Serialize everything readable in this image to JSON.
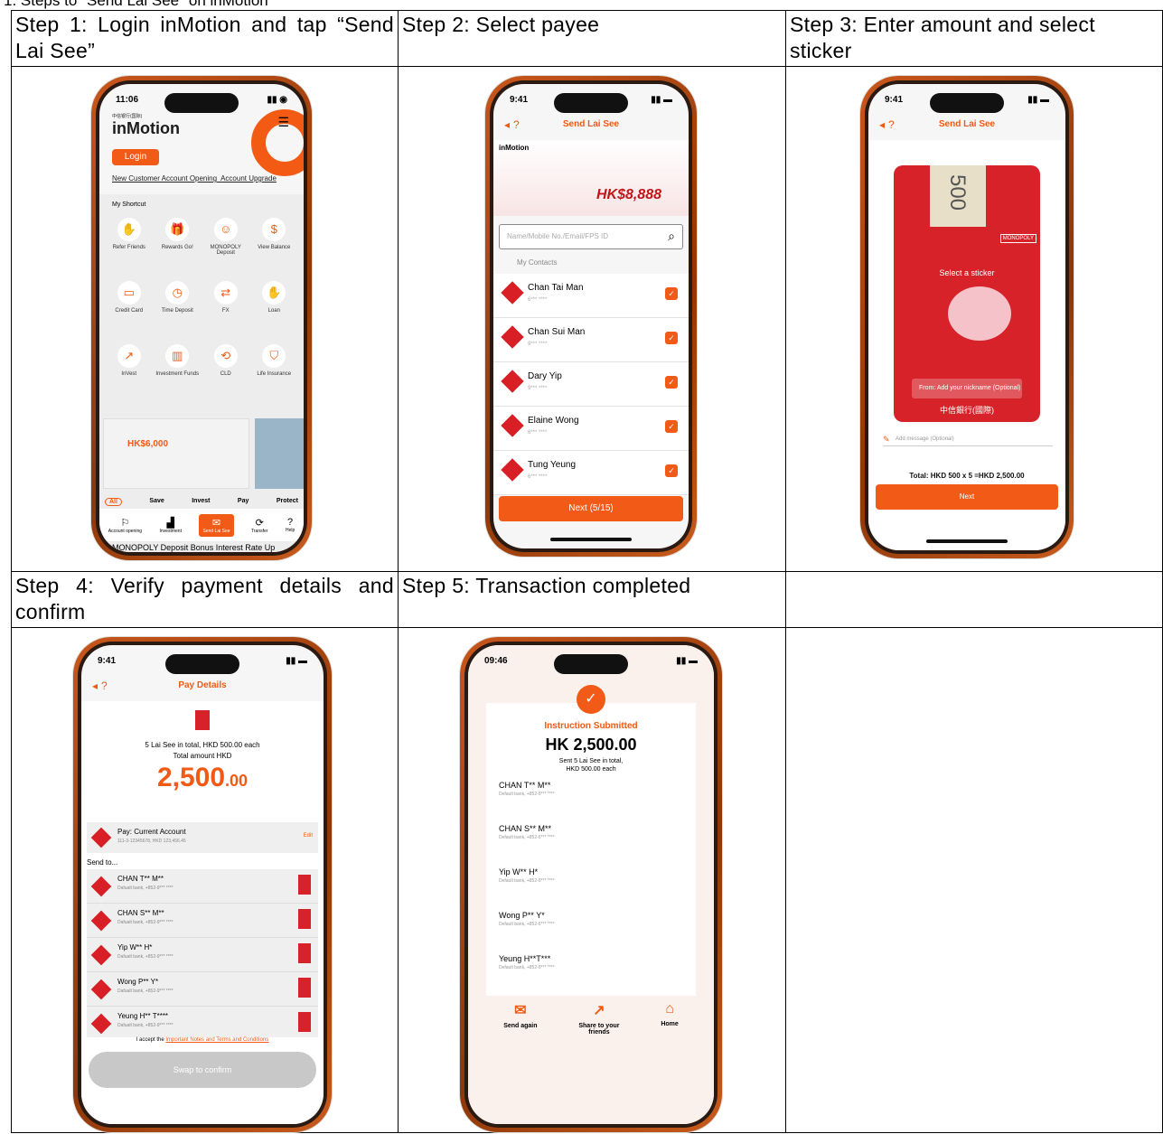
{
  "doc_title": "1.   Steps to \"Send Lai See\" on inMotion",
  "steps": [
    {
      "label": "Step 1: Login inMotion and tap “Send Lai See”"
    },
    {
      "label": "Step 2: Select payee"
    },
    {
      "label": "Step 3: Enter amount and select sticker"
    },
    {
      "label": "Step 4: Verify payment details and confirm"
    },
    {
      "label": "Step 5: Transaction completed"
    }
  ],
  "screen1": {
    "time": "11:06",
    "bank_name": "中信银行(国际)",
    "logo_text": "inMotion",
    "login_label": "Login",
    "link1": "New Customer Account Opening",
    "link2": "Account Upgrade",
    "shortcut_title": "My Shortcut",
    "shortcuts": [
      "Refer Friends",
      "Rewards Go!",
      "MONOPOLY Deposit",
      "View Balance",
      "Credit Card",
      "Time Deposit",
      "FX",
      "Loan",
      "InVest",
      "Investment Funds",
      "CLD",
      "Life Insurance"
    ],
    "banner_text": "HK$6,000",
    "tabs": [
      "All",
      "Save",
      "Invest",
      "Pay",
      "Protect"
    ],
    "nav": [
      "Account opening",
      "Investment",
      "Send Lai See",
      "Transfer",
      "Help"
    ],
    "ticker": "MONOPOLY Deposit Bonus Interest Rate Up"
  },
  "screen2": {
    "time": "9:41",
    "title": "Send Lai See",
    "banner_logo": "inMotion",
    "banner_prize": "HK$8,888",
    "search_placeholder": "Name/Mobile No./Email/FPS ID",
    "contacts_header": "My Contacts",
    "contacts": [
      {
        "name": "Chan Tai Man",
        "num": "6*** ****"
      },
      {
        "name": "Chan Sui Man",
        "num": "9*** ****"
      },
      {
        "name": "Dary Yip",
        "num": "9*** ****"
      },
      {
        "name": "Elaine Wong",
        "num": "6*** ****"
      },
      {
        "name": "Tung Yeung",
        "num": "6*** ****"
      }
    ],
    "next_label": "Next (5/15)"
  },
  "screen3": {
    "time": "9:41",
    "title": "Send Lai See",
    "note_value": "500",
    "monopoly": "MONOPOLY",
    "select_sticker": "Select a sticker",
    "from_label": "From:  Add your nickname (Optional)",
    "bank_label": "中信銀行(國際)",
    "message_placeholder": "Add message (Optional)",
    "total": "Total: HKD 500 x 5 =HKD 2,500.00",
    "next_label": "Next"
  },
  "screen4": {
    "time": "9:41",
    "title": "Pay Details",
    "summary": "5 Lai See in total, HKD 500.00 each",
    "total_label": "Total amount HKD",
    "amount_main": "2,500",
    "amount_dec": ".00",
    "pay_title": "Pay: Current Account",
    "pay_account": "111-3-12345678, HKD 123,456.45",
    "edit_label": "Edit",
    "send_to": "Send to...",
    "recipients": [
      {
        "name": "CHAN T** M**",
        "bank": "Dafualt bank, +852-9*** ****"
      },
      {
        "name": "CHAN S** M**",
        "bank": "Dafualt bank, +852-9*** ****"
      },
      {
        "name": "Yip W** H*",
        "bank": "Dafualt bank, +852-9*** ****"
      },
      {
        "name": "Wong P** Y*",
        "bank": "Dafualt bank, +852-9*** ****"
      },
      {
        "name": "Yeung H** T****",
        "bank": "Dafualt bank, +852-9*** ****"
      }
    ],
    "terms_prefix": "I accept the ",
    "terms_link": "Important Notes and Terms and Conditions",
    "swipe_label": "Swap to confirm"
  },
  "screen5": {
    "time": "09:46",
    "title": "Instruction Submitted",
    "amount": "HK 2,500.00",
    "sub1": "Sent 5 Lai See in total,",
    "sub2": "HKD 500.00 each",
    "recipients": [
      {
        "name": "CHAN T** M**",
        "bank": "Default bank, +852-9*** ****"
      },
      {
        "name": "CHAN S** M**",
        "bank": "Default bank, +852-6*** ****"
      },
      {
        "name": "Yip W** H*",
        "bank": "Default bank, +852-9*** ****"
      },
      {
        "name": "Wong P** Y*",
        "bank": "Default bank, +852-6*** ****"
      },
      {
        "name": "Yeung H**T***",
        "bank": "Default bank, +852-9*** ****"
      }
    ],
    "nav": [
      "Send again",
      "Share to your friends",
      "Home"
    ]
  }
}
